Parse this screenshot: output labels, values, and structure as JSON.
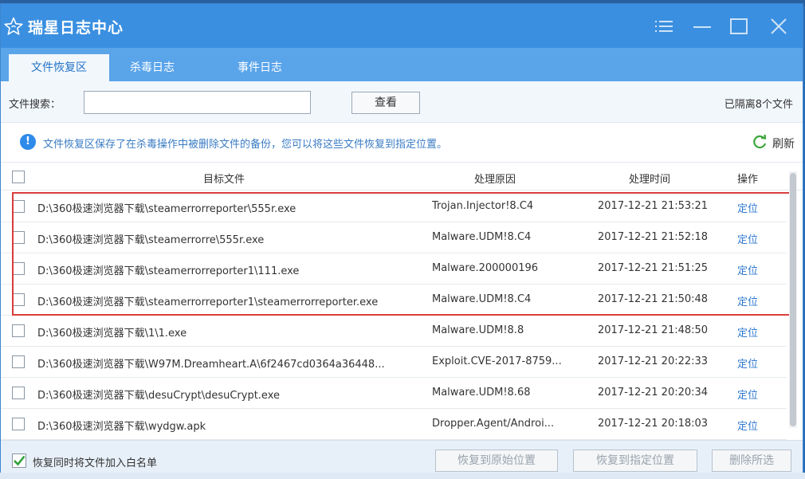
{
  "window": {
    "title": "瑞星日志中心"
  },
  "tabs": [
    {
      "label": "文件恢复区",
      "active": true
    },
    {
      "label": "杀毒日志",
      "active": false
    },
    {
      "label": "事件日志",
      "active": false
    }
  ],
  "search": {
    "label": "文件搜索：",
    "value": "",
    "placeholder": "",
    "button_label": "查看",
    "isolated_count_text": "已隔离8个文件"
  },
  "info": {
    "text": "文件恢复区保存了在杀毒操作中被删除文件的备份，您可以将这些文件恢复到指定位置。",
    "refresh_label": "刷新"
  },
  "table": {
    "headers": {
      "file": "目标文件",
      "reason": "处理原因",
      "time": "处理时间",
      "op": "操作"
    },
    "rows": [
      {
        "file": "D:\\360极速浏览器下载\\steamerrorreporter\\555r.exe",
        "reason": "Trojan.Injector!8.C4",
        "time": "2017-12-21 21:53:21",
        "op": "定位",
        "highlighted": true
      },
      {
        "file": "D:\\360极速浏览器下载\\steamerrorre\\555r.exe",
        "reason": "Malware.UDM!8.C4",
        "time": "2017-12-21 21:52:18",
        "op": "定位",
        "highlighted": true
      },
      {
        "file": "D:\\360极速浏览器下载\\steamerrorreporter1\\111.exe",
        "reason": "Malware.200000196",
        "time": "2017-12-21 21:51:25",
        "op": "定位",
        "highlighted": true
      },
      {
        "file": "D:\\360极速浏览器下载\\steamerrorreporter1\\steamerrorreporter.exe",
        "reason": "Malware.UDM!8.C4",
        "time": "2017-12-21 21:50:48",
        "op": "定位",
        "highlighted": true
      },
      {
        "file": "D:\\360极速浏览器下载\\1\\1.exe",
        "reason": "Malware.UDM!8.8",
        "time": "2017-12-21 21:48:50",
        "op": "定位",
        "highlighted": false
      },
      {
        "file": "D:\\360极速浏览器下载\\W97M.Dreamheart.A\\6f2467cd0364a36448...",
        "reason": "Exploit.CVE-2017-8759...",
        "time": "2017-12-21 20:22:33",
        "op": "定位",
        "highlighted": false
      },
      {
        "file": "D:\\360极速浏览器下载\\desuCrypt\\desuCrypt.exe",
        "reason": "Malware.UDM!8.68",
        "time": "2017-12-21 20:20:34",
        "op": "定位",
        "highlighted": false
      },
      {
        "file": "D:\\360极速浏览器下载\\wydgw.apk",
        "reason": "Dropper.Agent/Androi...",
        "time": "2017-12-21 20:18:03",
        "op": "定位",
        "highlighted": false
      }
    ]
  },
  "footer": {
    "whitelist_label": "恢复同时将文件加入白名单",
    "whitelist_checked": true,
    "restore_original_label": "恢复到原始位置",
    "restore_specified_label": "恢复到指定位置",
    "delete_selected_label": "删除所选"
  },
  "colors": {
    "titlebar": "#3a8fe0",
    "tabbar": "#5aa4ea",
    "link": "#2c78d0",
    "highlight_border": "#d93c3c",
    "info_text": "#3a7cc4",
    "refresh_icon": "#3aa63a"
  },
  "icons": {
    "app": "rising-star-logo-icon",
    "menu": "menu-icon",
    "minimize": "minimize-icon",
    "maximize": "maximize-icon",
    "close": "close-icon",
    "info": "info-icon",
    "refresh": "refresh-icon",
    "checkmark": "checkmark-icon"
  }
}
